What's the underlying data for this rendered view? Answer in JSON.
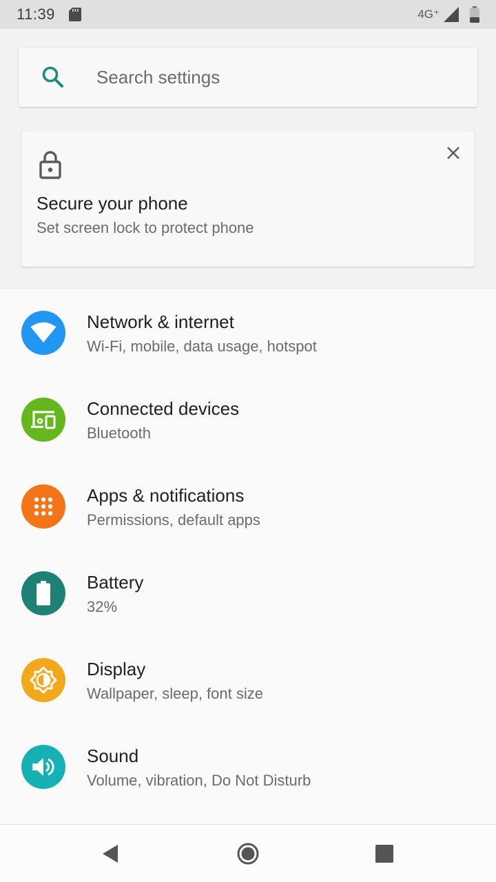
{
  "status_bar": {
    "time": "11:39",
    "network": "4G⁺",
    "sd_icon": "sd-card-icon",
    "signal_icon": "cell-signal-icon",
    "battery_icon": "battery-icon"
  },
  "search": {
    "placeholder": "Search settings",
    "icon": "search-icon",
    "accent": "#1a8a7d"
  },
  "suggestion_card": {
    "icon": "lock-icon",
    "title": "Secure your phone",
    "subtitle": "Set screen lock to protect phone",
    "dismiss_icon": "close-icon"
  },
  "settings": [
    {
      "id": "network",
      "title": "Network & internet",
      "subtitle": "Wi-Fi, mobile, data usage, hotspot",
      "icon": "wifi-icon",
      "color": "#2196f3"
    },
    {
      "id": "connected",
      "title": "Connected devices",
      "subtitle": "Bluetooth",
      "icon": "devices-icon",
      "color": "#64b81e"
    },
    {
      "id": "apps",
      "title": "Apps & notifications",
      "subtitle": "Permissions, default apps",
      "icon": "apps-grid-icon",
      "color": "#f57418"
    },
    {
      "id": "battery",
      "title": "Battery",
      "subtitle": "32%",
      "icon": "battery-icon",
      "color": "#1e8176"
    },
    {
      "id": "display",
      "title": "Display",
      "subtitle": "Wallpaper, sleep, font size",
      "icon": "brightness-icon",
      "color": "#f3a81c"
    },
    {
      "id": "sound",
      "title": "Sound",
      "subtitle": "Volume, vibration, Do Not Disturb",
      "icon": "volume-icon",
      "color": "#15b1b4"
    }
  ],
  "nav_bar": {
    "back_icon": "back-triangle-icon",
    "home_icon": "home-circle-icon",
    "recents_icon": "recents-square-icon"
  }
}
